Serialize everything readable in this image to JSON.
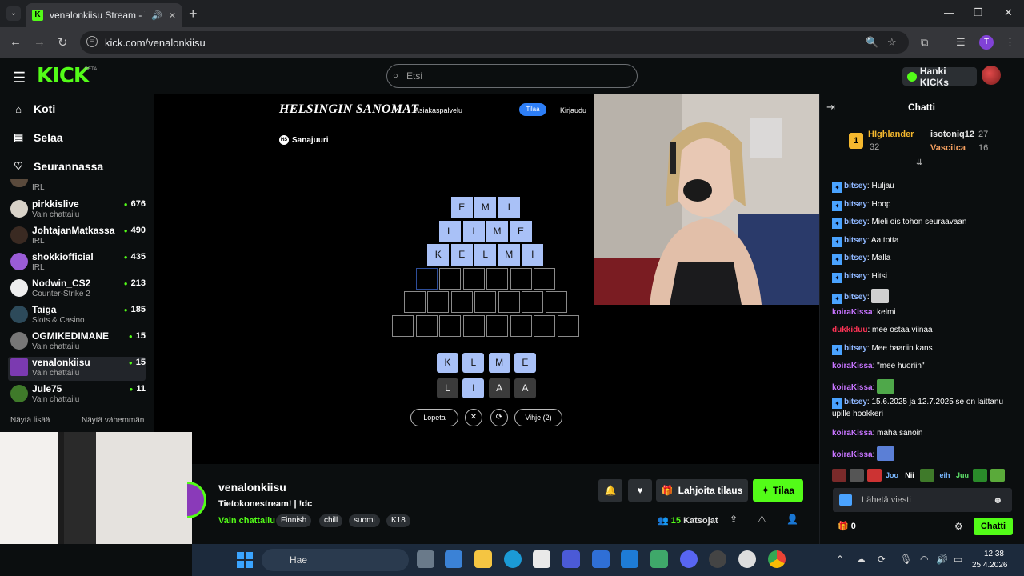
{
  "browser": {
    "tab_title": "venalonkiisu Stream - Watch",
    "new_tab_label": "+",
    "url": "kick.com/venalonkiisu",
    "profile_initial": "T"
  },
  "kick": {
    "logo": "KICK",
    "beta": "BETA",
    "search_placeholder": "Etsi",
    "hanki_label": "Hanki KICKs"
  },
  "sidebar": {
    "nav": [
      {
        "label": "Koti",
        "icon": "home-icon"
      },
      {
        "label": "Selaa",
        "icon": "browse-icon"
      },
      {
        "label": "Seurannassa",
        "icon": "heart-icon"
      }
    ],
    "partial_category": "IRL",
    "channels": [
      {
        "name": "pirkkislive",
        "category": "Vain chattailu",
        "viewers": "676"
      },
      {
        "name": "JohtajanMatkassa",
        "category": "IRL",
        "viewers": "490"
      },
      {
        "name": "shokkiofficial",
        "category": "IRL",
        "viewers": "435"
      },
      {
        "name": "Nodwin_CS2",
        "category": "Counter-Strike 2",
        "viewers": "213"
      },
      {
        "name": "Taiga",
        "category": "Slots & Casino",
        "viewers": "185"
      },
      {
        "name": "OGMIKEDIMANE",
        "category": "Vain chattailu",
        "viewers": "15"
      },
      {
        "name": "venalonkiisu",
        "category": "Vain chattailu",
        "viewers": "15"
      },
      {
        "name": "Jule75",
        "category": "Vain chattailu",
        "viewers": "11"
      }
    ],
    "show_more": "Näytä lisää",
    "show_less": "Näytä vähemmän"
  },
  "game": {
    "brand": "HELSINGIN SANOMAT",
    "asiakaspalvelu": "Asiakaspalvelu",
    "tilaa": "Tilaa",
    "kirjaudu": "Kirjaudu",
    "hs_badge": "HS",
    "sanajuuri": "Sanajuuri",
    "rows": [
      [
        "E",
        "M",
        "I"
      ],
      [
        "L",
        "I",
        "M",
        "E"
      ],
      [
        "K",
        "E",
        "L",
        "M",
        "I"
      ],
      [
        "",
        "",
        "",
        "",
        "",
        ""
      ],
      [
        "",
        "",
        "",
        "",
        "",
        "",
        ""
      ],
      [
        "",
        "",
        "",
        "",
        "",
        "",
        "",
        ""
      ]
    ],
    "keys_top": [
      "K",
      "L",
      "M",
      "E"
    ],
    "keys_bottom": [
      "L",
      "I",
      "A",
      "A"
    ],
    "lopeta": "Lopeta",
    "vihje": "Vihje (2)"
  },
  "stream": {
    "name": "venalonkiisu",
    "title": "Tietokonestream! | !dc",
    "category": "Vain chattailu",
    "tags": [
      "Finnish",
      "chill",
      "suomi",
      "K18"
    ],
    "gift_label": "Lahjoita tilaus",
    "subscribe_label": "Tilaa",
    "viewers": "15",
    "viewers_label": "Katsojat"
  },
  "chat": {
    "title": "Chatti",
    "top_gifters": [
      {
        "name": "HIghlander",
        "count": "32",
        "rank": "1"
      },
      {
        "name": "isotoniq12",
        "count": "27"
      },
      {
        "name": "Vascitca",
        "count": "16"
      }
    ],
    "messages": [
      {
        "user": "bitsey",
        "text": "Huljau",
        "color": "#8fb7ff",
        "badge": true
      },
      {
        "user": "bitsey",
        "text": "Hoop",
        "color": "#8fb7ff",
        "badge": true
      },
      {
        "user": "bitsey",
        "text": "Mieli ois tohon seuraavaan",
        "color": "#8fb7ff",
        "badge": true
      },
      {
        "user": "bitsey",
        "text": "Aa totta",
        "color": "#8fb7ff",
        "badge": true
      },
      {
        "user": "bitsey",
        "text": "Malla",
        "color": "#8fb7ff",
        "badge": true
      },
      {
        "user": "bitsey",
        "text": "Hitsi",
        "color": "#8fb7ff",
        "badge": true
      },
      {
        "user": "bitsey",
        "text": "",
        "color": "#8fb7ff",
        "badge": true,
        "emote": "#cfcfcf"
      },
      {
        "user": "koiraKissa",
        "text": "kelmi",
        "color": "#c774ff",
        "badge": false
      },
      {
        "user": "dukkiduu",
        "text": "mee ostaa viinaa",
        "color": "#ff3355",
        "badge": false
      },
      {
        "user": "bitsey",
        "text": "Mee baariin kans",
        "color": "#8fb7ff",
        "badge": true
      },
      {
        "user": "koiraKissa",
        "text": "\"mee huoriin\"",
        "color": "#c774ff",
        "badge": false
      },
      {
        "user": "koiraKissa",
        "text": "",
        "color": "#c774ff",
        "badge": false,
        "emote": "#4fa84a"
      },
      {
        "user": "bitsey",
        "text": "15.6.2025 ja 12.7.2025 se on laittanu upille hookkeri",
        "color": "#8fb7ff",
        "badge": true
      },
      {
        "user": "koiraKissa",
        "text": "mähä sanoin",
        "color": "#c774ff",
        "badge": false
      },
      {
        "user": "koiraKissa",
        "text": "",
        "color": "#c774ff",
        "badge": false,
        "emote": "#5b7fd6"
      }
    ],
    "emote_bar": [
      "",
      "",
      "",
      "Joo",
      "Nii",
      "",
      "eih",
      "Juu",
      "",
      ""
    ],
    "input_placeholder": "Lähetä viesti",
    "points": "0",
    "chat_button": "Chatti"
  },
  "taskbar": {
    "search_placeholder": "Hae",
    "time": "12.38",
    "date": "25.4.2026"
  }
}
